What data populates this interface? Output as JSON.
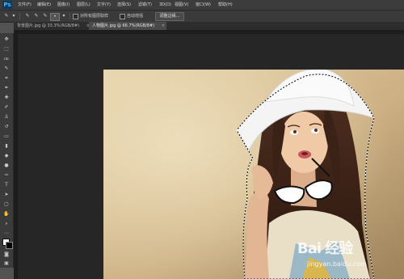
{
  "app": {
    "logo": "Ps"
  },
  "menu": [
    "文件(F)",
    "编辑(E)",
    "图像(I)",
    "图层(L)",
    "文字(Y)",
    "选择(S)",
    "滤镜(T)",
    "3D(D)",
    "视图(V)",
    "窗口(W)",
    "帮助(H)"
  ],
  "options": {
    "antialias_label": "对所有图层取样",
    "auto_enhance_label": "自动增强",
    "refine_edge_button": "调整边缘..."
  },
  "tabs": [
    {
      "label": "背景图片.jpg @ 33.3%(RGB/8#)",
      "close": "×",
      "active": false
    },
    {
      "label": "人物图片.jpg @ 66.7%(RGB/8#)",
      "close": "×",
      "active": true
    }
  ],
  "watermark": {
    "brand": "Bai 经验",
    "url": "jingyan.baidu.com"
  }
}
